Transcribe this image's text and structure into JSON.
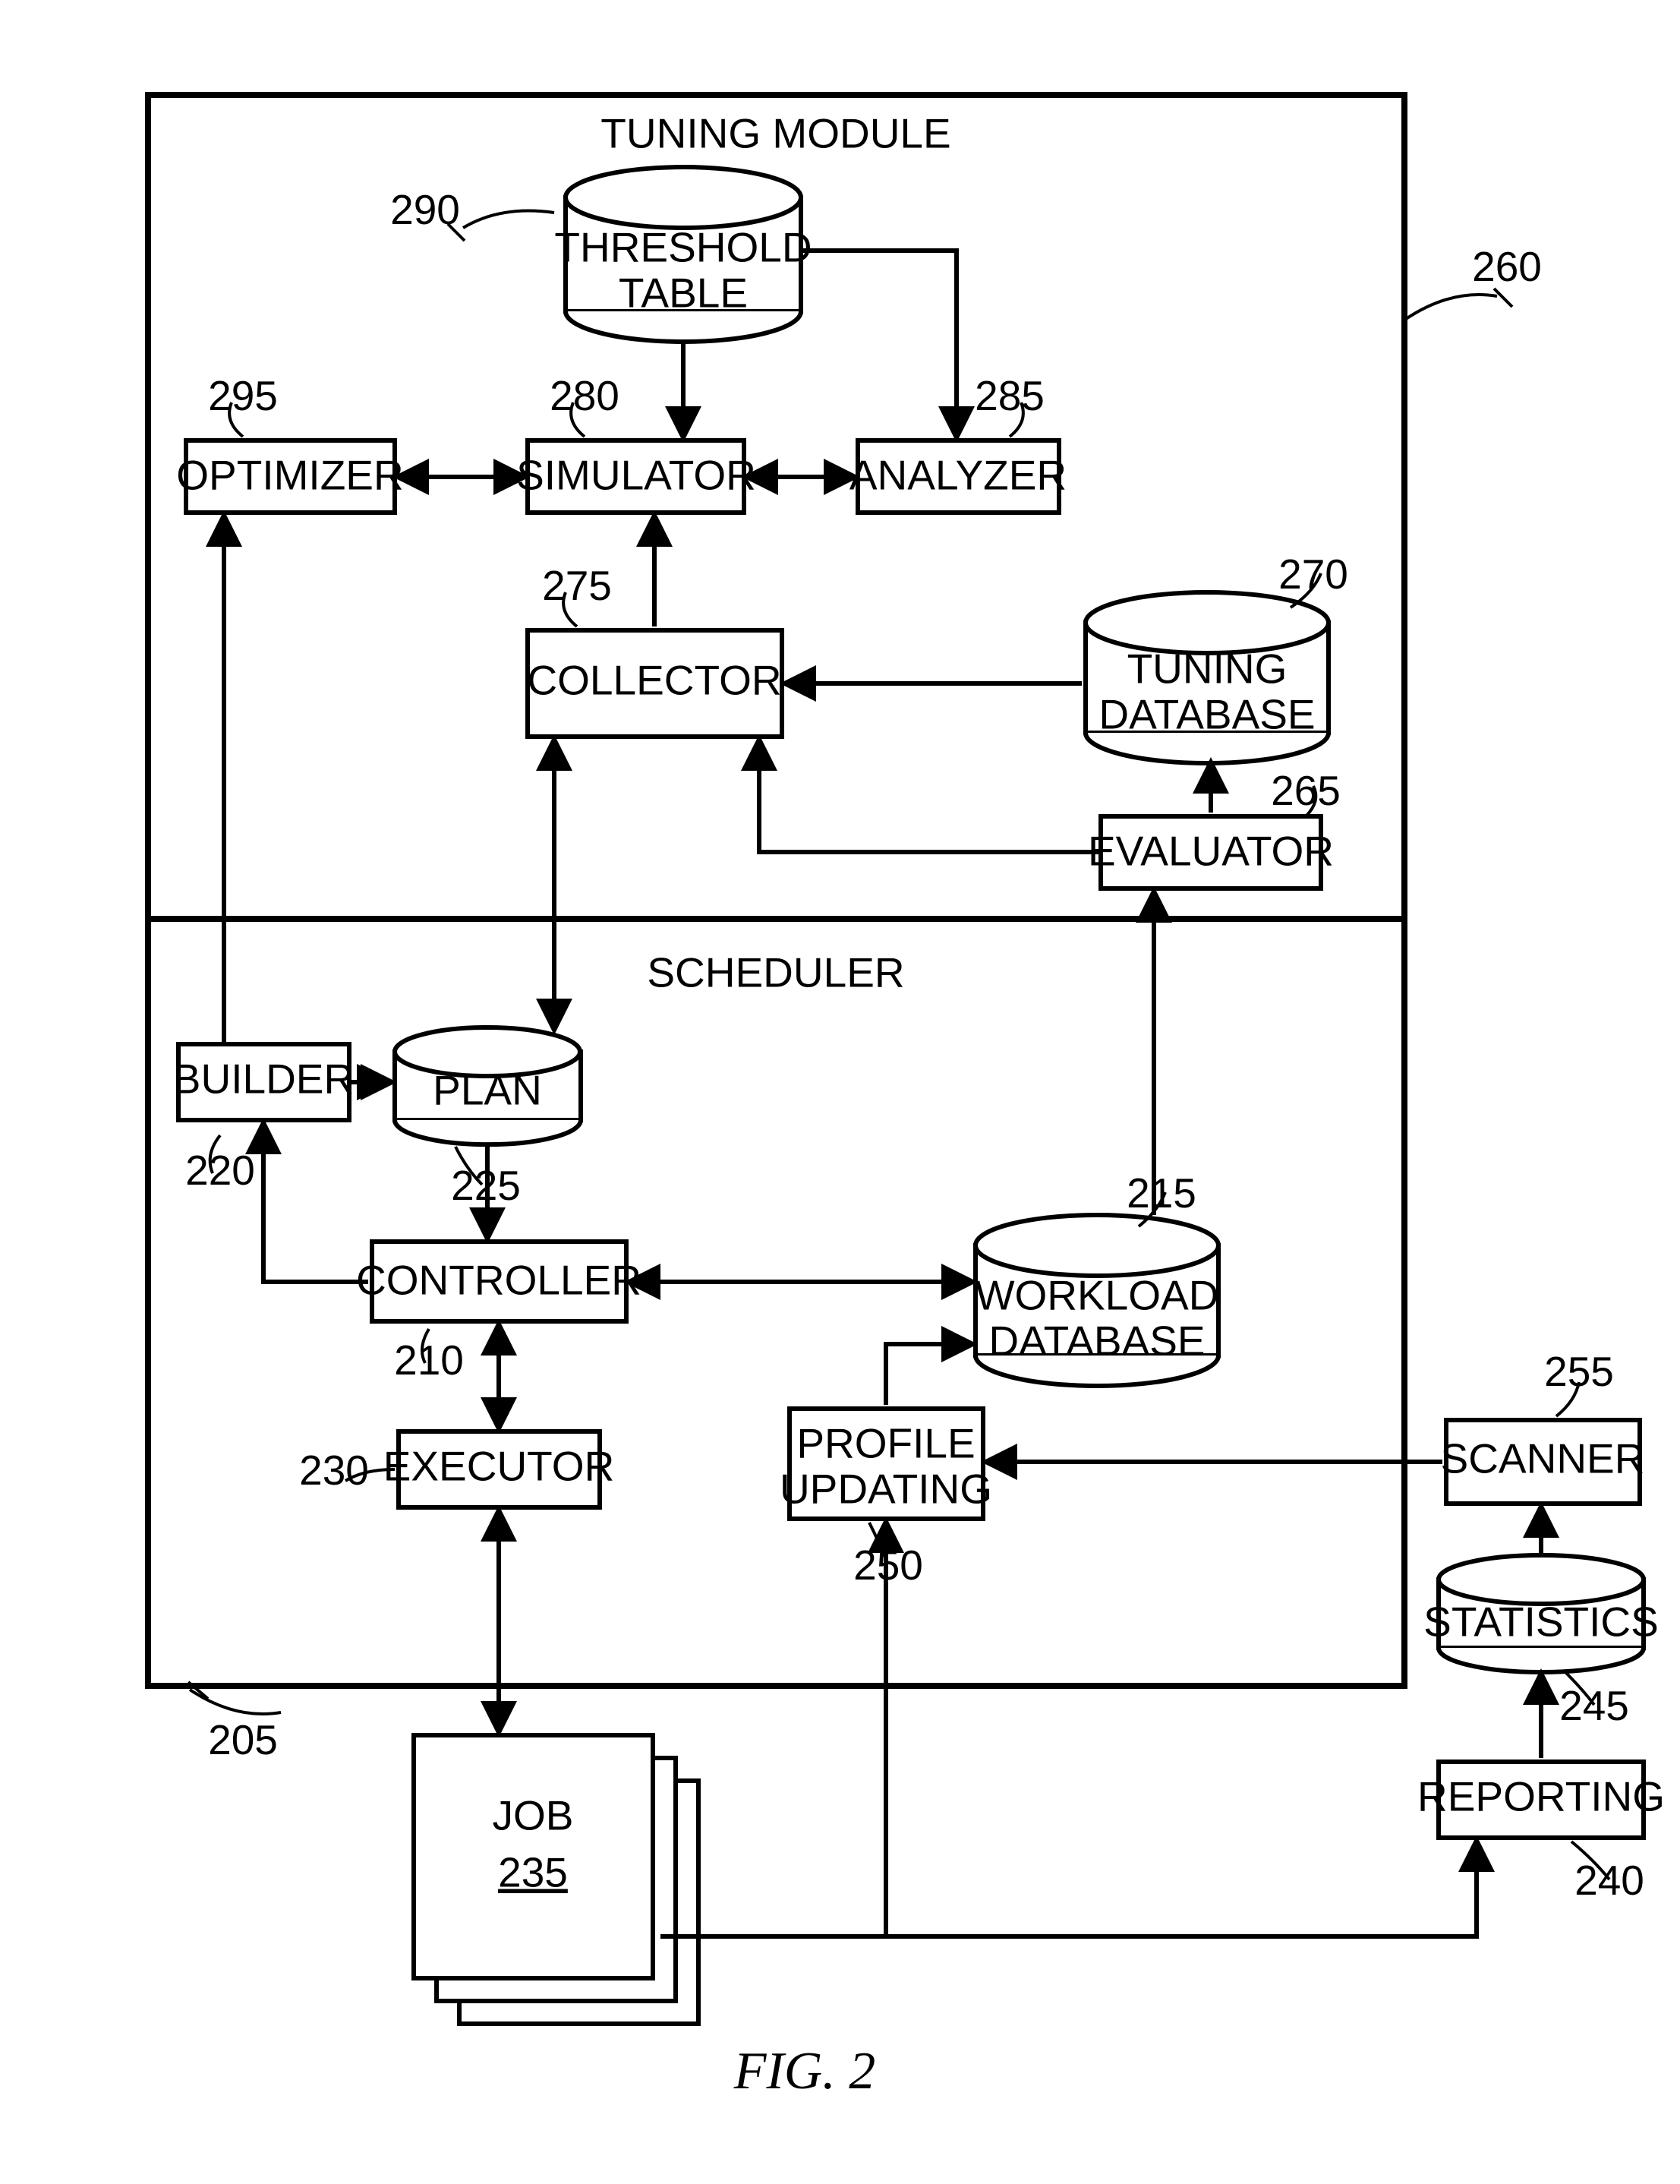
{
  "figureCaption": "FIG. 2",
  "modules": {
    "tuningModule": {
      "title": "TUNING MODULE",
      "ref": "260"
    },
    "scheduler": {
      "title": "SCHEDULER",
      "ref": "205"
    }
  },
  "blocks": {
    "optimizer": {
      "label": "OPTIMIZER",
      "ref": "295"
    },
    "simulator": {
      "label": "SIMULATOR",
      "ref": "280"
    },
    "analyzer": {
      "label": "ANALYZER",
      "ref": "285"
    },
    "collector": {
      "label": "COLLECTOR",
      "ref": "275"
    },
    "evaluator": {
      "label": "EVALUATOR",
      "ref": "265"
    },
    "builder": {
      "label": "BUILDER",
      "ref": "220"
    },
    "controller": {
      "label": "CONTROLLER",
      "ref": "210"
    },
    "executor": {
      "label": "EXECUTOR",
      "ref": "230"
    },
    "profileUpdating": {
      "label1": "PROFILE",
      "label2": "UPDATING",
      "ref": "250"
    },
    "scanner": {
      "label": "SCANNER",
      "ref": "255"
    },
    "reporting": {
      "label": "REPORTING",
      "ref": "240"
    },
    "job": {
      "label": "JOB",
      "ref": "235"
    }
  },
  "databases": {
    "thresholdTable": {
      "label1": "THRESHOLD",
      "label2": "TABLE",
      "ref": "290"
    },
    "tuningDatabase": {
      "label1": "TUNING",
      "label2": "DATABASE",
      "ref": "270"
    },
    "plan": {
      "label": "PLAN",
      "ref": "225"
    },
    "workloadDatabase": {
      "label1": "WORKLOAD",
      "label2": "DATABASE",
      "ref": "215"
    },
    "statistics": {
      "label": "STATISTICS",
      "ref": "245"
    }
  }
}
